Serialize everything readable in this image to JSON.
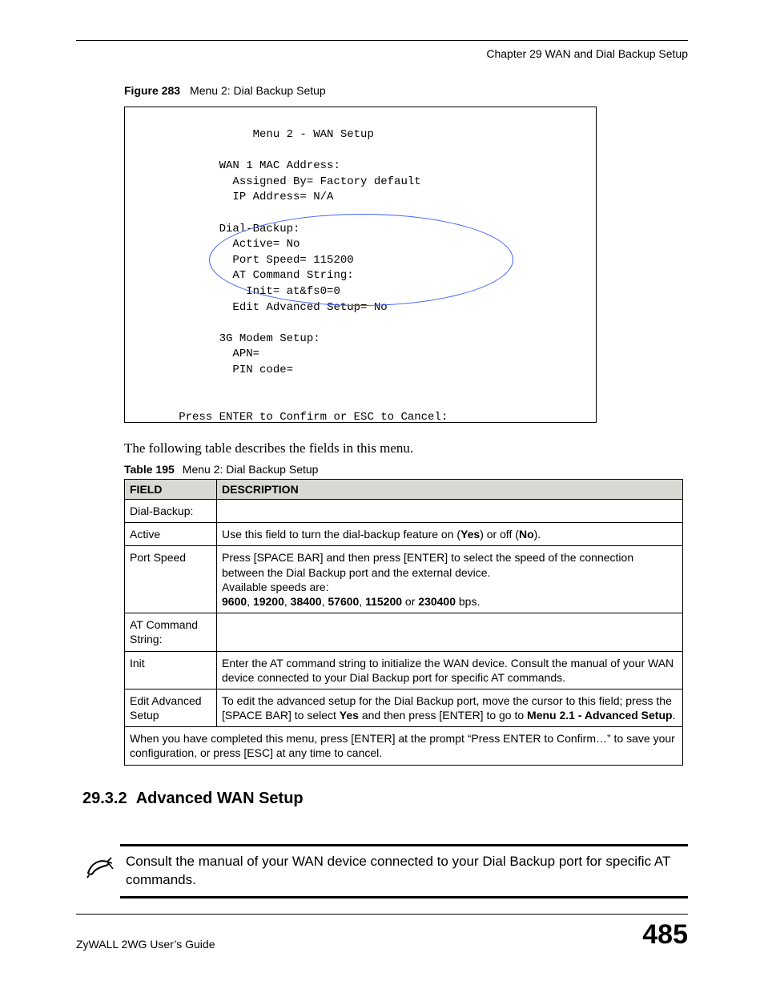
{
  "header": {
    "chapter_line": "Chapter 29 WAN and Dial Backup Setup"
  },
  "figure": {
    "label": "Figure 283",
    "title": "Menu 2: Dial Backup Setup",
    "terminal": "                   Menu 2 - WAN Setup\n\n              WAN 1 MAC Address:\n                Assigned By= Factory default\n                IP Address= N/A\n\n              Dial-Backup:\n                Active= No\n                Port Speed= 115200\n                AT Command String:\n                  Init= at&fs0=0\n                Edit Advanced Setup= No\n\n              3G Modem Setup:\n                APN=\n                PIN code=\n\n\n        Press ENTER to Confirm or ESC to Cancel:"
  },
  "intro_text": "The following table describes the fields in this menu.",
  "table": {
    "label": "Table 195",
    "title": "Menu 2: Dial Backup Setup",
    "headers": {
      "field": "FIELD",
      "desc": "DESCRIPTION"
    },
    "rows": [
      {
        "field": "Dial-Backup:",
        "desc_html": ""
      },
      {
        "field": "Active",
        "desc_html": "Use this field to turn the dial-backup feature on (<b>Yes</b>) or off (<b>No</b>)."
      },
      {
        "field": "Port Speed",
        "desc_html": "Press [SPACE BAR] and then press [ENTER] to select the speed of the connection between the Dial Backup port and the external device.<br>Available speeds are:<br><b>9600</b>, <b>19200</b>, <b>38400</b>, <b>57600</b>, <b>115200</b> or <b>230400</b> bps."
      },
      {
        "field": "AT Command String:",
        "desc_html": ""
      },
      {
        "field": "Init",
        "desc_html": "Enter the AT command string to initialize the WAN device. Consult the manual of your WAN device connected to your Dial Backup port for specific AT commands."
      },
      {
        "field": "Edit Advanced Setup",
        "desc_html": "To edit the advanced setup for the Dial Backup port, move the cursor to this field; press the [SPACE BAR] to select <b>Yes</b> and then press [ENTER] to go to <b>Menu 2.1 - Advanced Setup</b>."
      }
    ],
    "footer_row": "When you have completed this menu, press [ENTER] at the prompt “Press ENTER to Confirm…” to save your configuration, or press [ESC] at any time to cancel."
  },
  "section": {
    "number": "29.3.2",
    "title": "Advanced WAN Setup"
  },
  "note": {
    "text": "Consult the manual of your WAN device connected to your Dial Backup port for specific AT commands."
  },
  "footer": {
    "guide": "ZyWALL 2WG User’s Guide",
    "page": "485"
  }
}
